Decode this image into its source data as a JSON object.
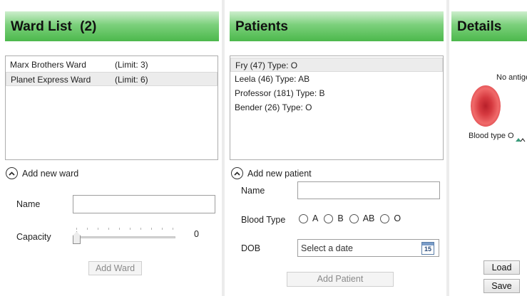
{
  "ward_panel": {
    "title": "Ward List",
    "count": "(2)",
    "wards": [
      {
        "name": "Marx Brothers Ward",
        "limit": "(Limit: 3)"
      },
      {
        "name": "Planet Express Ward",
        "limit": "(Limit: 6)"
      }
    ],
    "add_expander_label": "Add new ward",
    "name_label": "Name",
    "name_value": "",
    "capacity_label": "Capacity",
    "capacity_value": "0",
    "add_button_label": "Add Ward"
  },
  "patients_panel": {
    "title": "Patients",
    "patients": [
      {
        "text": "Fry (47) Type: O"
      },
      {
        "text": "Leela (46) Type: AB"
      },
      {
        "text": "Professor (181) Type: B"
      },
      {
        "text": "Bender (26) Type: O"
      }
    ],
    "add_expander_label": "Add new patient",
    "name_label": "Name",
    "name_value": "",
    "blood_type_label": "Blood Type",
    "blood_types": [
      "A",
      "B",
      "AB",
      "O"
    ],
    "dob_label": "DOB",
    "dob_placeholder": "Select a date",
    "calendar_day": "15",
    "add_button_label": "Add Patient"
  },
  "details_panel": {
    "title": "Details",
    "antigen_text": "No antige",
    "blood_type_text": "Blood type O",
    "load_button_label": "Load",
    "save_button_label": "Save"
  }
}
